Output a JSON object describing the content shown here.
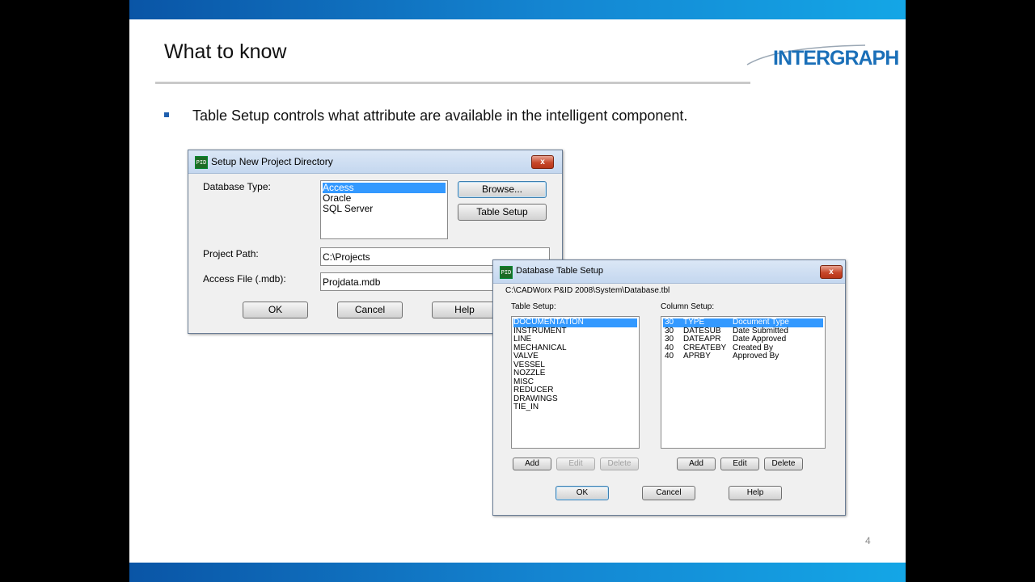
{
  "slide": {
    "title": "What to know",
    "logo": "INTERGRAPH",
    "bullet": "Table Setup controls what attribute are available in the intelligent component.",
    "page_number": "4"
  },
  "colors": {
    "bar": "#1486d2",
    "logo": "#1a6fb8",
    "selection": "#3399ff"
  },
  "dialog1": {
    "title": "Setup New Project Directory",
    "db_type_label": "Database Type:",
    "db_types": [
      "Access",
      "Oracle",
      "SQL Server"
    ],
    "selected_db": "Access",
    "browse_label": "Browse...",
    "table_setup_label": "Table Setup",
    "project_path_label": "Project Path:",
    "project_path_value": "C:\\Projects",
    "access_file_label": "Access File (.mdb):",
    "access_file_value": "Projdata.mdb",
    "ok_label": "OK",
    "cancel_label": "Cancel",
    "help_label": "Help",
    "close_label": "x"
  },
  "dialog2": {
    "title": "Database Table Setup",
    "path": "C:\\CADWorx P&ID 2008\\System\\Database.tbl",
    "table_setup_label": "Table Setup:",
    "tables": [
      "DOCUMENTATION",
      "INSTRUMENT",
      "LINE",
      "MECHANICAL",
      "VALVE",
      "VESSEL",
      "NOZZLE",
      "MISC",
      "REDUCER",
      "DRAWINGS",
      "TIE_IN"
    ],
    "column_setup_label": "Column Setup:",
    "columns": [
      {
        "size": "30",
        "name": "TYPE",
        "desc": "Document Type"
      },
      {
        "size": "30",
        "name": "DATESUB",
        "desc": "Date Submitted"
      },
      {
        "size": "30",
        "name": "DATEAPR",
        "desc": "Date Approved"
      },
      {
        "size": "40",
        "name": "CREATEBY",
        "desc": "Created By"
      },
      {
        "size": "40",
        "name": "APRBY",
        "desc": "Approved By"
      }
    ],
    "add_label": "Add",
    "edit_label": "Edit",
    "delete_label": "Delete",
    "ok_label": "OK",
    "cancel_label": "Cancel",
    "help_label": "Help",
    "close_label": "x"
  }
}
